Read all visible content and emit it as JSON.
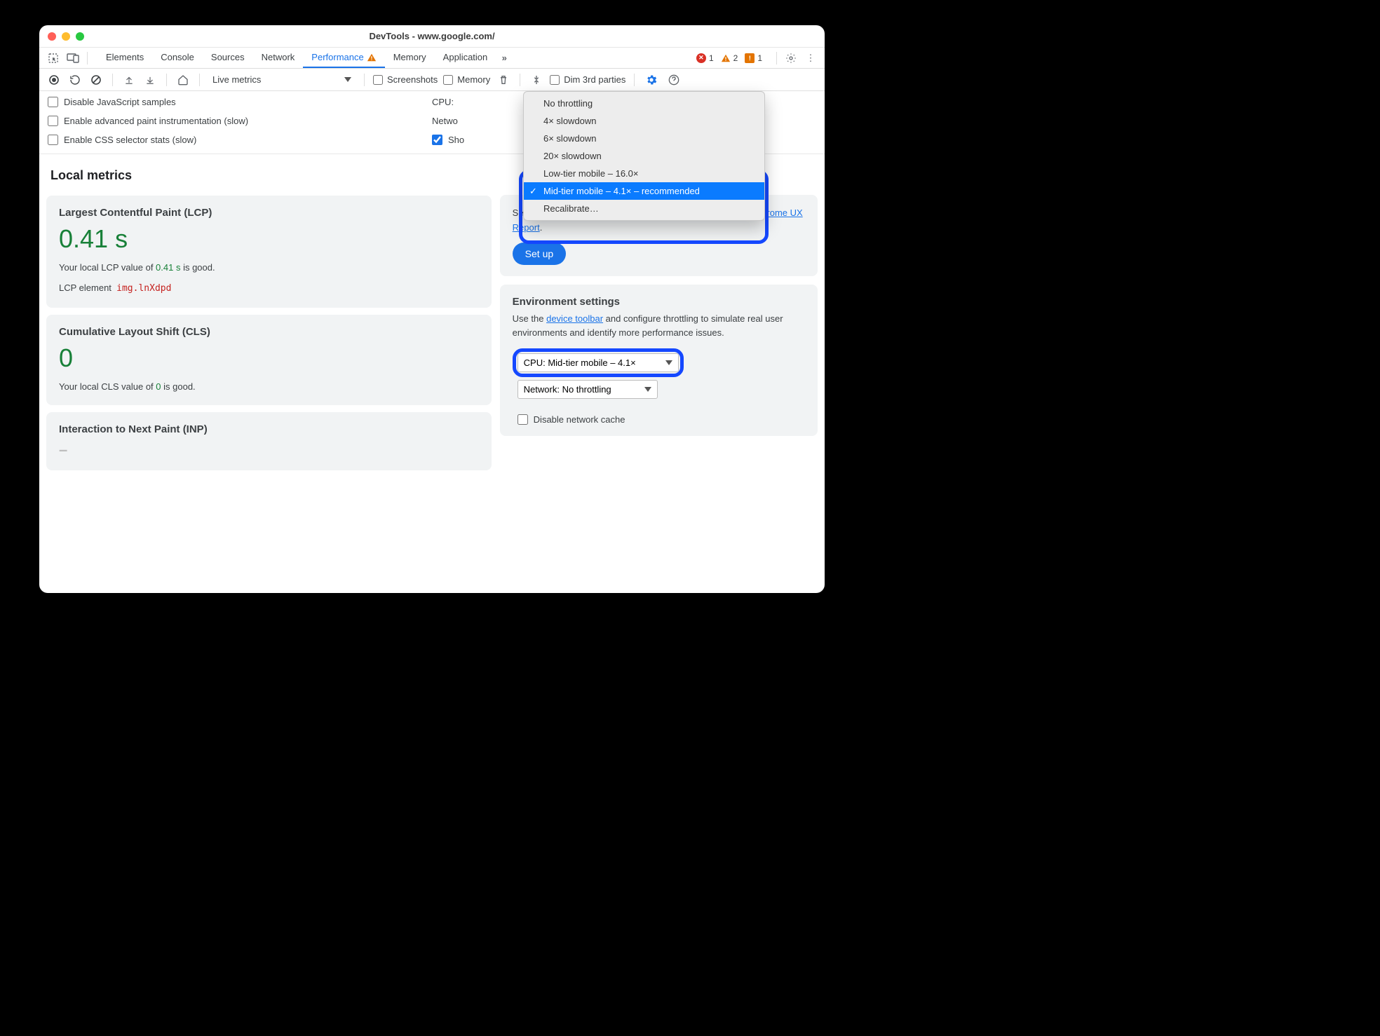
{
  "window_title": "DevTools - www.google.com/",
  "tabs": {
    "elements": "Elements",
    "console": "Console",
    "sources": "Sources",
    "network": "Network",
    "performance": "Performance",
    "memory": "Memory",
    "application": "Application"
  },
  "badge_counts": {
    "errors": "1",
    "warnings": "2",
    "issues": "1"
  },
  "toolbar": {
    "metrics_select": "Live metrics",
    "screenshots": "Screenshots",
    "memory": "Memory",
    "dim": "Dim 3rd parties"
  },
  "settings": {
    "disable_js": "Disable JavaScript samples",
    "adv_paint": "Enable advanced paint instrumentation (slow)",
    "css_sel": "Enable CSS selector stats (slow)",
    "cpu_label": "CPU:",
    "network_label_clipped": "Netwo",
    "show_label_clipped": "Sho"
  },
  "dropdown": {
    "none": "No throttling",
    "opt4": "4× slowdown",
    "opt6": "6× slowdown",
    "opt20": "20× slowdown",
    "low": "Low-tier mobile – 16.0×",
    "mid": "Mid-tier mobile – 4.1× – recommended",
    "recal": "Recalibrate…"
  },
  "metrics": {
    "section": "Local metrics",
    "lcp": {
      "title": "Largest Contentful Paint (LCP)",
      "value": "0.41 s",
      "line_pre": "Your local LCP value of ",
      "line_val": "0.41 s",
      "line_post": " is good.",
      "el_label": "LCP element",
      "el_val": "img.lnXdpd"
    },
    "cls": {
      "title": "Cumulative Layout Shift (CLS)",
      "value": "0",
      "line_pre": "Your local CLS value of ",
      "line_val": "0",
      "line_post": " is good."
    },
    "inp": {
      "title": "Interaction to Next Paint (INP)",
      "value": "–"
    }
  },
  "crux": {
    "text_pre": "See how your local metrics compare to real user data in the ",
    "link": "Chrome UX Report",
    "text_post": ".",
    "button": "Set up"
  },
  "env": {
    "title": "Environment settings",
    "text_pre": "Use the ",
    "link": "device toolbar",
    "text_post": " and configure throttling to simulate real user environments and identify more performance issues.",
    "cpu_select": "CPU: Mid-tier mobile – 4.1×",
    "net_select": "Network: No throttling",
    "disable_cache": "Disable network cache"
  }
}
